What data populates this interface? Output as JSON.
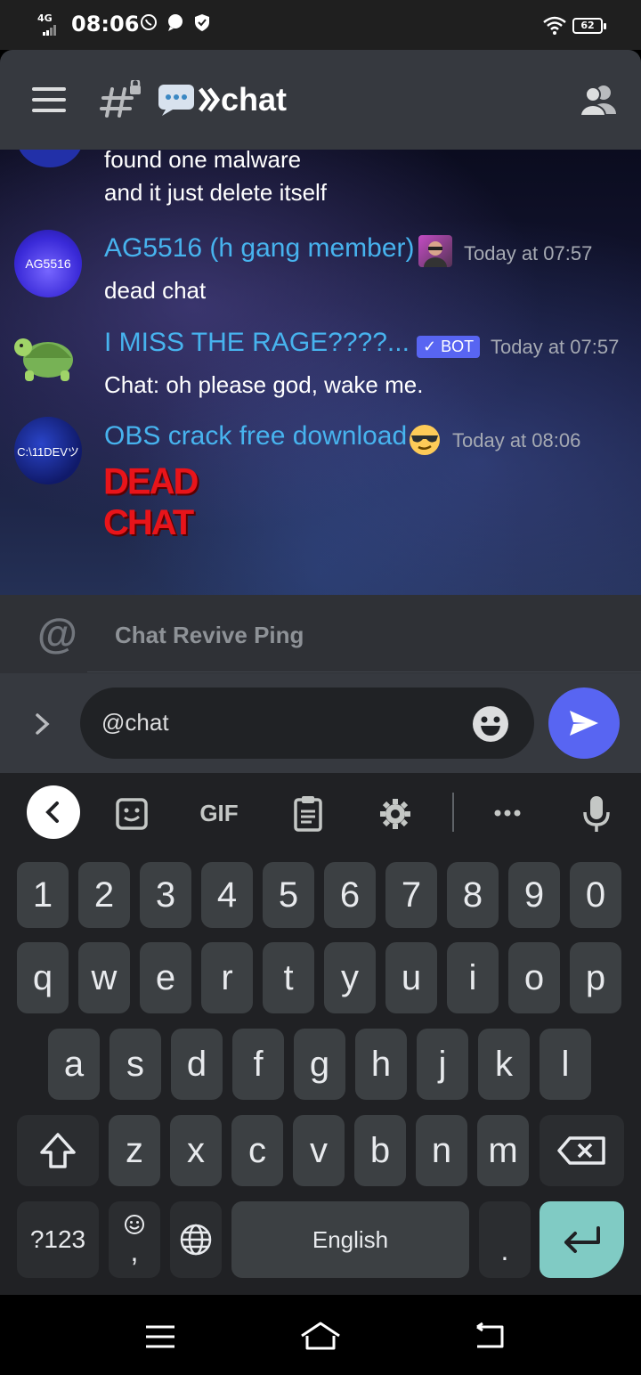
{
  "status_bar": {
    "network": "4G",
    "time": "08:06",
    "battery": "62"
  },
  "header": {
    "channel_name": "chat",
    "channel_emoji": "💬⟫"
  },
  "messages": [
    {
      "lines": [
        "found one malware",
        "and it just delete itself"
      ]
    },
    {
      "author": "AG5516 (h gang member)",
      "avatar_text": "AG5516",
      "timestamp": "Today at 07:57",
      "text": "dead chat"
    },
    {
      "author": "I MISS THE RAGE????...",
      "bot_tag": "✓ BOT",
      "timestamp": "Today at 07:57",
      "text": "Chat: oh please god, wake me."
    },
    {
      "author": "OBS crack free download",
      "avatar_text": "C:\\11DEVツ",
      "timestamp": "Today at 08:06",
      "sticker_lines": [
        "DEAD",
        "CHAT"
      ]
    }
  ],
  "mention_suggestion": {
    "label": "Chat Revive Ping"
  },
  "composer": {
    "value": "@chat"
  },
  "keyboard": {
    "toolbar": {
      "gif": "GIF"
    },
    "row_numbers": [
      "1",
      "2",
      "3",
      "4",
      "5",
      "6",
      "7",
      "8",
      "9",
      "0"
    ],
    "row1": [
      "q",
      "w",
      "e",
      "r",
      "t",
      "y",
      "u",
      "i",
      "o",
      "p"
    ],
    "row2": [
      "a",
      "s",
      "d",
      "f",
      "g",
      "h",
      "j",
      "k",
      "l"
    ],
    "row3": [
      "z",
      "x",
      "c",
      "v",
      "b",
      "n",
      "m"
    ],
    "symbols_key": "?123",
    "comma_key": ",",
    "space_key": "English",
    "period_key": "."
  },
  "colors": {
    "accent": "#5865f2",
    "author": "#47b3ee",
    "enter_key": "#80cbc4"
  }
}
